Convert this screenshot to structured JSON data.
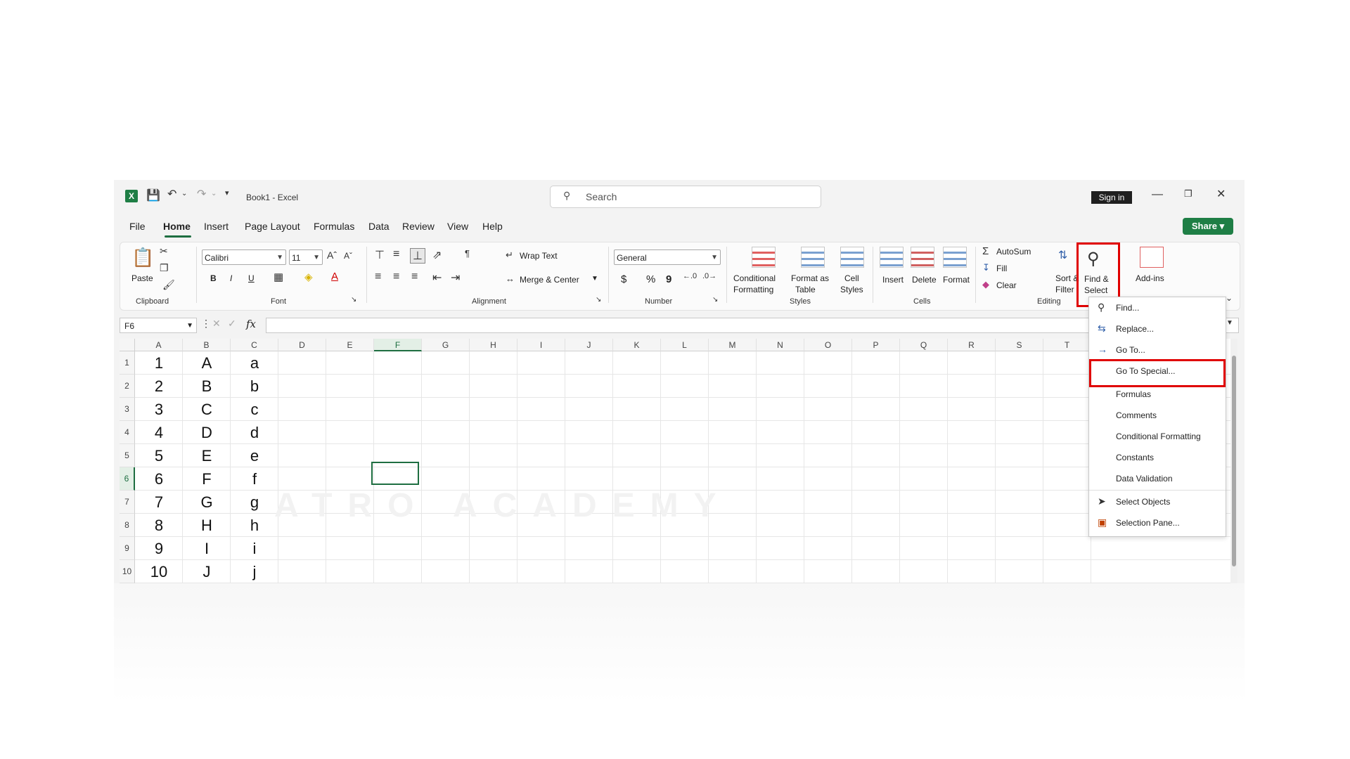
{
  "titlebar": {
    "doc_name": "Book1",
    "separator": "-",
    "app_name": "Excel",
    "search_placeholder": "Search",
    "sign_in": "Sign in"
  },
  "menu": {
    "items": [
      "File",
      "Home",
      "Insert",
      "Page Layout",
      "Formulas",
      "Data",
      "Review",
      "View",
      "Help"
    ],
    "active": "Home",
    "share": "Share"
  },
  "ribbon": {
    "clipboard": {
      "paste": "Paste",
      "group": "Clipboard"
    },
    "font": {
      "name": "Calibri",
      "size": "11",
      "group": "Font",
      "bold": "B",
      "italic": "I",
      "underline": "U"
    },
    "alignment": {
      "wrap": "Wrap Text",
      "merge": "Merge & Center",
      "group": "Alignment"
    },
    "number": {
      "format": "General",
      "group": "Number",
      "currency": "$",
      "percent": "%",
      "comma": "9"
    },
    "styles": {
      "cond1": "Conditional",
      "cond2": "Formatting",
      "fmt1": "Format as",
      "fmt2": "Table",
      "cell1": "Cell",
      "cell2": "Styles",
      "group": "Styles"
    },
    "cells": {
      "insert": "Insert",
      "delete": "Delete",
      "format": "Format",
      "group": "Cells"
    },
    "editing": {
      "autosum": "AutoSum",
      "fill": "Fill",
      "clear": "Clear",
      "sort1": "Sort &",
      "sort2": "Filter",
      "find1": "Find &",
      "find2": "Select",
      "group": "Editing"
    },
    "addins": "Add-ins"
  },
  "formula_bar": {
    "name_box": "F6",
    "fx": "fx"
  },
  "grid": {
    "columns": [
      "A",
      "B",
      "C",
      "D",
      "E",
      "F",
      "G",
      "H",
      "I",
      "J",
      "K",
      "L",
      "M",
      "N",
      "O",
      "P",
      "Q",
      "R",
      "S",
      "T"
    ],
    "selected_col": "F",
    "rows": [
      "1",
      "2",
      "3",
      "4",
      "5",
      "6",
      "7",
      "8",
      "9",
      "10"
    ],
    "selected_row": "6",
    "col_a": [
      "1",
      "2",
      "3",
      "4",
      "5",
      "6",
      "7",
      "8",
      "9",
      "10"
    ],
    "col_b": [
      "A",
      "B",
      "C",
      "D",
      "E",
      "F",
      "G",
      "H",
      "I",
      "J"
    ],
    "col_c": [
      "a",
      "b",
      "c",
      "d",
      "e",
      "f",
      "g",
      "h",
      "i",
      "j"
    ]
  },
  "dropdown": {
    "items": [
      "Find...",
      "Replace...",
      "Go To...",
      "Go To Special...",
      "Formulas",
      "Comments",
      "Conditional Formatting",
      "Constants",
      "Data Validation",
      "Select Objects",
      "Selection Pane..."
    ],
    "highlighted": "Go To Special..."
  },
  "watermark": "ATRO ACADEMY",
  "colors": {
    "excel_green": "#1e6e41",
    "highlight_red": "#e00000",
    "share_green": "#1e7e45"
  }
}
